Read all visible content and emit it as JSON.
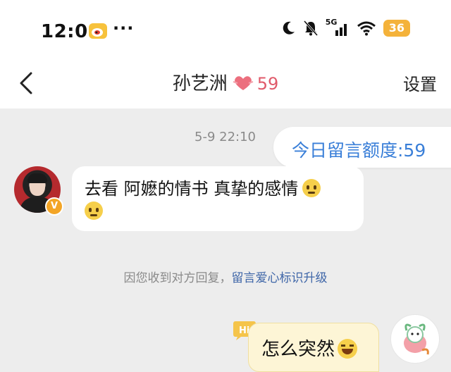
{
  "status_bar": {
    "time": "12:01",
    "more": "···",
    "signal": "5G",
    "battery": "36"
  },
  "nav": {
    "title": "孙艺洲",
    "intimacy": "59",
    "settings_label": "设置"
  },
  "chat": {
    "timestamp": "5-9 22:10",
    "quota": "今日留言额度:59",
    "messages": [
      {
        "side": "left",
        "text": "去看 阿嬷的情书 真挚的感情"
      },
      {
        "side": "right",
        "text": "怎么突然"
      }
    ],
    "notice_prefix": "因您收到对方回复，",
    "notice_link": "留言爱心标识升级",
    "hi_badge": "Hi"
  },
  "icons": {
    "back": "chevron-left-icon",
    "weibo": "weibo-icon",
    "heart": "heart-icon",
    "moon": "moon-icon",
    "mute": "bell-off-icon",
    "wifi": "wifi-icon",
    "verified": "verified-badge-icon"
  },
  "colors": {
    "accent_blue": "#3a7fd8",
    "heart_pink": "#e05a6a",
    "battery": "#f4b23a",
    "right_bubble": "#fdf5d6"
  }
}
